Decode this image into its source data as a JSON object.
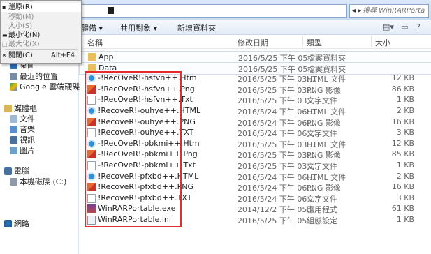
{
  "window": {
    "search_placeholder": "搜尋 WinRARPorta",
    "nav_arrows": "◂ ▸"
  },
  "toolbar": {
    "organize": "體備 ▾",
    "share": "共用對象 ▾",
    "new_folder": "新增資料夾"
  },
  "system_menu": {
    "items": [
      {
        "label": "還原(R)",
        "shortcut": "",
        "disabled": false,
        "glyph": "▪"
      },
      {
        "label": "移動(M)",
        "shortcut": "",
        "disabled": true,
        "glyph": ""
      },
      {
        "label": "大小(S)",
        "shortcut": "",
        "disabled": true,
        "glyph": ""
      },
      {
        "label": "最小化(N)",
        "shortcut": "",
        "disabled": false,
        "glyph": "▬"
      },
      {
        "label": "最大化(X)",
        "shortcut": "",
        "disabled": true,
        "glyph": "□"
      },
      {
        "label": "關閉(C)",
        "shortcut": "Alt+F4",
        "disabled": false,
        "glyph": "✕"
      }
    ]
  },
  "nav": {
    "desktop": "桌面",
    "recent": "最近的位置",
    "gdrive": "Google 雲端硬碟",
    "libraries": "媒體櫃",
    "documents": "文件",
    "music": "音樂",
    "videos": "視訊",
    "pictures": "圖片",
    "computer": "電腦",
    "local_disk": "本機磁碟 (C:)",
    "network": "網路"
  },
  "columns": {
    "name": "名稱",
    "date": "修改日期",
    "type": "類型",
    "size": "大小"
  },
  "files": [
    {
      "name": "App",
      "date": "2016/5/25 下午 05:...",
      "type": "檔案資料夾",
      "size": "",
      "kind": "folder"
    },
    {
      "name": "Data",
      "date": "2016/5/25 下午 05:...",
      "type": "檔案資料夾",
      "size": "",
      "kind": "folder"
    },
    {
      "name": "-!RecOveR!-hsfvn++.Htm",
      "date": "2016/5/25 下午 03:...",
      "type": "HTML 文件",
      "size": "12 KB",
      "kind": "htm"
    },
    {
      "name": "-!RecOveR!-hsfvn++.Png",
      "date": "2016/5/25 下午 03:...",
      "type": "PNG 影像",
      "size": "86 KB",
      "kind": "png"
    },
    {
      "name": "-!RecOveR!-hsfvn++.Txt",
      "date": "2016/5/25 下午 03:...",
      "type": "文字文件",
      "size": "1 KB",
      "kind": "txt"
    },
    {
      "name": "!RecoveR!-ouhye++.HTML",
      "date": "2016/5/24 下午 06:...",
      "type": "HTML 文件",
      "size": "2 KB",
      "kind": "htm"
    },
    {
      "name": "!RecoveR!-ouhye++.PNG",
      "date": "2016/5/24 下午 06:...",
      "type": "PNG 影像",
      "size": "16 KB",
      "kind": "png"
    },
    {
      "name": "!RecoveR!-ouhye++.TXT",
      "date": "2016/5/24 下午 06:...",
      "type": "文字文件",
      "size": "3 KB",
      "kind": "txt"
    },
    {
      "name": "-!RecOveR!-pbkmi++.Htm",
      "date": "2016/5/25 下午 03:...",
      "type": "HTML 文件",
      "size": "12 KB",
      "kind": "htm"
    },
    {
      "name": "-!RecOveR!-pbkmi++.Png",
      "date": "2016/5/25 下午 03:...",
      "type": "PNG 影像",
      "size": "85 KB",
      "kind": "png"
    },
    {
      "name": "-!RecOveR!-pbkmi++.Txt",
      "date": "2016/5/25 下午 03:...",
      "type": "文字文件",
      "size": "1 KB",
      "kind": "txt"
    },
    {
      "name": "!RecoveR!-pfxbd++.HTML",
      "date": "2016/5/24 下午 06:...",
      "type": "HTML 文件",
      "size": "2 KB",
      "kind": "htm"
    },
    {
      "name": "!RecoveR!-pfxbd++.PNG",
      "date": "2016/5/24 下午 06:...",
      "type": "PNG 影像",
      "size": "16 KB",
      "kind": "png"
    },
    {
      "name": "!RecoveR!-pfxbd++.TXT",
      "date": "2016/5/24 下午 06:...",
      "type": "文字文件",
      "size": "3 KB",
      "kind": "txt"
    },
    {
      "name": "WinRARPortable.exe",
      "date": "2014/12/2 下午 05:...",
      "type": "應用程式",
      "size": "61 KB",
      "kind": "exe"
    },
    {
      "name": "WinRARPortable.ini",
      "date": "2016/5/25 下午 05:...",
      "type": "組態設定",
      "size": "1 KB",
      "kind": "ini"
    }
  ]
}
